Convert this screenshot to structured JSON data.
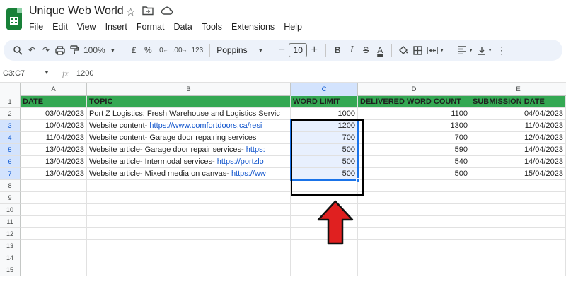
{
  "doc": {
    "title": "Unique Web World",
    "title_icons": [
      "star-icon",
      "move-to-folder-icon",
      "cloud-status-icon"
    ]
  },
  "menu": [
    "File",
    "Edit",
    "View",
    "Insert",
    "Format",
    "Data",
    "Tools",
    "Extensions",
    "Help"
  ],
  "toolbar": {
    "zoom": "100%",
    "currency": "£",
    "percent": "%",
    "decimal_decrease": ".0",
    "decimal_increase": ".00",
    "number_format": "123",
    "font": "Poppins",
    "font_size": "10",
    "bold": "B",
    "italic": "I",
    "strike": "S",
    "text_color": "A"
  },
  "formula_bar": {
    "name_box": "C3:C7",
    "fx": "fx",
    "value": "1200"
  },
  "columns": [
    "A",
    "B",
    "C",
    "D",
    "E"
  ],
  "rows": [
    "1",
    "2",
    "3",
    "4",
    "5",
    "6",
    "7",
    "8",
    "9",
    "10",
    "11",
    "12",
    "13",
    "14",
    "15"
  ],
  "headers": {
    "date": "DATE",
    "topic": "TOPIC",
    "word_limit": "WORD LIMIT",
    "delivered": "DELIVERED WORD COUNT",
    "submission": "SUBMISSION DATE"
  },
  "data_rows": [
    {
      "date": "03/04/2023",
      "topic_text": "Port Z Logistics: Fresh Warehouse and Logistics Servic",
      "topic_link": "",
      "limit": "1000",
      "delivered": "1100",
      "submission": "04/04/2023"
    },
    {
      "date": "10/04/2023",
      "topic_text": "Website content- ",
      "topic_link": "https://www.comfortdoors.ca/resi",
      "limit": "1200",
      "delivered": "1300",
      "submission": "11/04/2023"
    },
    {
      "date": "11/04/2023",
      "topic_text": "Website content- Garage door repairing services",
      "topic_link": "",
      "limit": "700",
      "delivered": "700",
      "submission": "12/04/2023"
    },
    {
      "date": "13/04/2023",
      "topic_text": "Website article- Garage door repair services- ",
      "topic_link": "https:",
      "limit": "500",
      "delivered": "590",
      "submission": "14/04/2023"
    },
    {
      "date": "13/04/2023",
      "topic_text": "Website article- Intermodal services- ",
      "topic_link": "https://portzlo",
      "limit": "500",
      "delivered": "540",
      "submission": "14/04/2023"
    },
    {
      "date": "13/04/2023",
      "topic_text": "Website article- Mixed media on canvas- ",
      "topic_link": "https://ww",
      "limit": "500",
      "delivered": "500",
      "submission": "15/04/2023"
    }
  ],
  "colors": {
    "header_green": "#34a853",
    "selection_blue": "#1a73e8",
    "annotation_arrow": "#e02020"
  }
}
